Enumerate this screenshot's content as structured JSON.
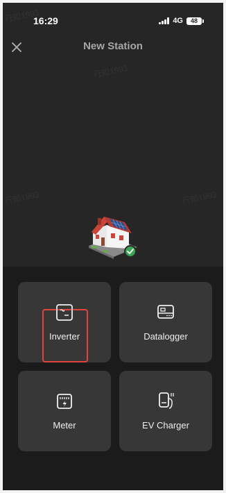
{
  "status_bar": {
    "time": "16:29",
    "network": "4G",
    "battery": "48"
  },
  "header": {
    "title": "New Station",
    "close_icon": "close-icon"
  },
  "hero": {
    "image": "house-with-solar-panels",
    "badge_icon": "check-icon"
  },
  "devices": [
    {
      "label": "Inverter",
      "icon": "inverter-icon",
      "selected": true
    },
    {
      "label": "Datalogger",
      "icon": "datalogger-icon"
    },
    {
      "label": "Meter",
      "icon": "meter-icon"
    },
    {
      "label": "EV Charger",
      "icon": "ev-charger-icon"
    }
  ],
  "colors": {
    "background": "#262626",
    "panel": "#1b1b1b",
    "tile": "#373737",
    "highlight": "#e5443c",
    "badge": "#3aa757"
  },
  "watermark": "行知1993"
}
